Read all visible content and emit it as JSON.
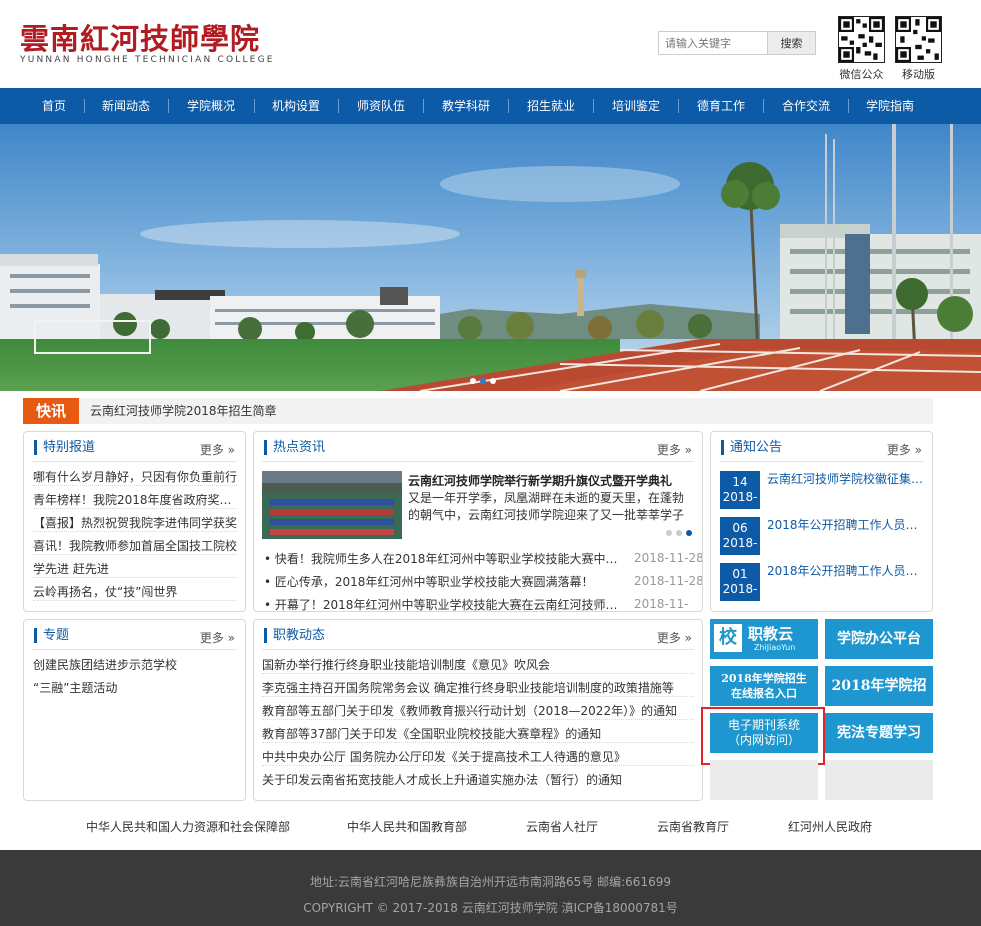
{
  "header": {
    "logo_cn": "雲南紅河技師學院",
    "logo_en": "YUNNAN HONGHE TECHNICIAN COLLEGE",
    "search_placeholder": "请输入关键字",
    "search_button": "搜索",
    "qr_wechat_label": "微信公众号",
    "qr_mobile_label": "移动版"
  },
  "nav": [
    "首页",
    "新闻动态",
    "学院概况",
    "机构设置",
    "师资队伍",
    "教学科研",
    "招生就业",
    "培训鉴定",
    "德育工作",
    "合作交流",
    "学院指南"
  ],
  "flash": {
    "tag": "快讯",
    "text": "云南红河技师学院2018年招生简章"
  },
  "special": {
    "title": "特别报道",
    "more": "更多 »",
    "items": [
      "哪有什么岁月静好，只因有你负重前行",
      "青年榜样！我院2018年度省政府奖学金",
      "【喜报】热烈祝贺我院李进伟同学获奖",
      "喜讯！我院教师参加首届全国技工院校",
      "学先进 赶先进",
      "云岭再扬名，仗“技”闯世界"
    ]
  },
  "hot": {
    "title": "热点资讯",
    "more": "更多 »",
    "feature_title": "云南红河技师学院举行新学期升旗仪式暨开学典礼",
    "feature_text": "又是一年开学季，凤凰湖畔在未逝的夏天里，在蓬勃的朝气中，云南红河技师学院迎来了又一批莘莘学子",
    "items": [
      {
        "text": "快看！我院师生多人在2018年红河州中等职业学校技能大赛中获奖",
        "date": "2018-11-28"
      },
      {
        "text": "匠心传承，2018年红河州中等职业学校技能大赛圆满落幕！",
        "date": "2018-11-28"
      },
      {
        "text": "开幕了！2018年红河州中等职业学校技能大赛在云南红河技师学院开幕",
        "date": "2018-11-"
      }
    ]
  },
  "notice": {
    "title": "通知公告",
    "more": "更多 »",
    "items": [
      {
        "day": "14",
        "ym": "2018-",
        "text": "云南红河技师学院校徽征集启事"
      },
      {
        "day": "06",
        "ym": "2018-",
        "text": "2018年公开招聘工作人员面试公告"
      },
      {
        "day": "01",
        "ym": "2018-",
        "text": "2018年公开招聘工作人员面试公告"
      }
    ]
  },
  "topic": {
    "title": "专题",
    "more": "更多 »",
    "items": [
      "创建民族团结进步示范学校",
      "“三融”主题活动"
    ]
  },
  "voc": {
    "title": "职教动态",
    "more": "更多 »",
    "items": [
      "国新办举行推行终身职业技能培训制度《意见》吹风会",
      "李克强主持召开国务院常务会议 确定推行终身职业技能培训制度的政策措施等",
      "教育部等五部门关于印发《教师教育振兴行动计划（2018—2022年）》的通知",
      "教育部等37部门关于印发《全国职业院校技能大赛章程》的通知",
      "中共中央办公厅 国务院办公厅印发《关于提高技术工人待遇的意见》",
      "关于印发云南省拓宽技能人才成长上升通道实施办法（暂行）的通知"
    ]
  },
  "side_buttons": {
    "zjy_logo": "校",
    "zjy_cn": "职教云",
    "zjy_en": "ZhiJiaoYun",
    "office": "学院办公平台",
    "enroll_online": "2018年学院招生\n在线报名入口",
    "enroll": "2018年学院招生",
    "journal": "电子期刊系统\n（内网访问）",
    "constitution": "宪法专题学习"
  },
  "links": [
    "中华人民共和国人力资源和社会保障部",
    "中华人民共和国教育部",
    "云南省人社厅",
    "云南省教育厅",
    "红河州人民政府"
  ],
  "footer": {
    "address": "地址:云南省红河哈尼族彝族自治州开远市南洞路65号  邮编:661699",
    "copyright": "COPYRIGHT © 2017-2018 云南红河技师学院  滇ICP备18000781号"
  },
  "colors": {
    "nav": "#0d5aa7",
    "accent": "#e85a12",
    "tile": "#1e96cf",
    "logo": "#b01c22",
    "highlight": "#e1262a"
  }
}
